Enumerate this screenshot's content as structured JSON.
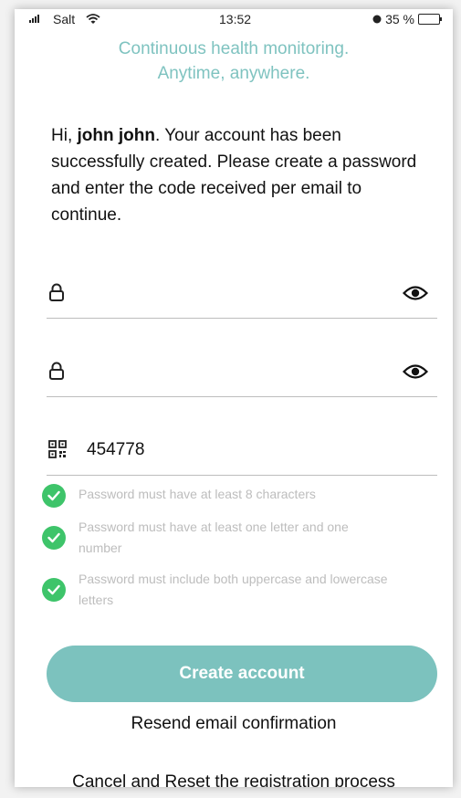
{
  "status_bar": {
    "carrier": "Salt",
    "time": "13:52",
    "battery": "35 %",
    "battery_level": 0.35
  },
  "tagline": {
    "line1": "Continuous health monitoring.",
    "line2": "Anytime, anywhere."
  },
  "greeting": {
    "prefix": "Hi, ",
    "name": "john john",
    "message": ". Your account has been successfully created. Please create a password and enter the code received per email to continue."
  },
  "form": {
    "password_value": "",
    "confirm_password_value": "",
    "code_value": "454778"
  },
  "requirements": [
    {
      "text": "Password must have at least 8 characters"
    },
    {
      "text": "Password must have at least one letter and one number"
    },
    {
      "text": "Password must include both uppercase and lowercase letters"
    }
  ],
  "actions": {
    "create_account": "Create account",
    "resend_email": "Resend email confirmation",
    "cancel_reset": "Cancel and Reset the registration process"
  },
  "colors": {
    "accent": "#7cc2be",
    "tagline": "#7fc3c0",
    "success": "#3ec46a",
    "muted_text": "#bdbdbd"
  },
  "icons": {
    "password_field": "lock-icon",
    "visibility": "eye-icon",
    "code_field": "qr-code-icon",
    "requirement": "check-circle-icon"
  }
}
